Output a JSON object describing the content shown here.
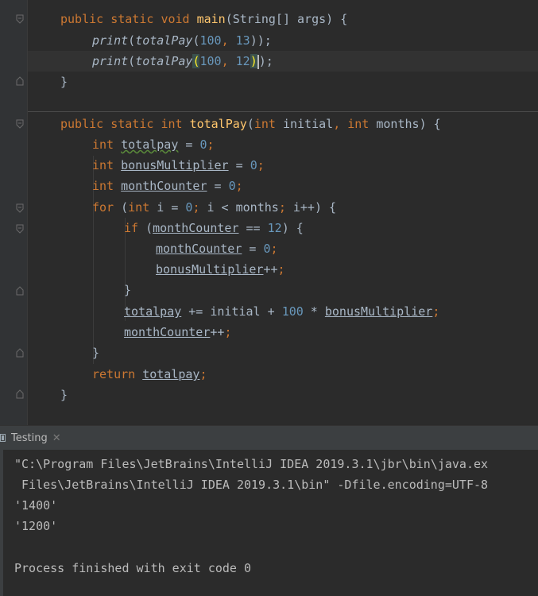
{
  "editor": {
    "main_sig": {
      "kw1": "public",
      "kw2": "static",
      "kw3": "void",
      "name": "main",
      "params": "(String[] args) {"
    },
    "print1": {
      "fn": "print",
      "inner": "totalPay",
      "a": "100",
      "b": "13",
      "close": "));"
    },
    "print2": {
      "fn": "print",
      "inner": "totalPay",
      "a": "100",
      "b": "12",
      "close": ");"
    },
    "close1": "}",
    "total_sig": {
      "kw1": "public",
      "kw2": "static",
      "kw3": "int",
      "name": "totalPay",
      "p1t": "int",
      "p1": "initial",
      "p2t": "int",
      "p2": "months",
      "end": ") {"
    },
    "decl1": {
      "type": "int",
      "name": "totalpay",
      "val": "0"
    },
    "decl2": {
      "type": "int",
      "name": "bonusMultiplier",
      "val": "0"
    },
    "decl3": {
      "type": "int",
      "name": "monthCounter",
      "val": "0"
    },
    "for_line": {
      "kw": "for",
      "t": "int",
      "v": "i",
      "zero": "0",
      "cond": "i < months",
      "inc": "i++"
    },
    "if_line": {
      "kw": "if",
      "var": "monthCounter",
      "op": "==",
      "num": "12"
    },
    "assign1": {
      "var": "monthCounter",
      "val": "0"
    },
    "inc1": {
      "var": "bonusMultiplier",
      "op": "++"
    },
    "close_if": "}",
    "accum": {
      "var": "totalpay",
      "op": "+=",
      "rhs": "initial + ",
      "num": "100",
      "mul": " * ",
      "var2": "bonusMultiplier"
    },
    "inc2": {
      "var": "monthCounter",
      "op": "++"
    },
    "close_for": "}",
    "ret": {
      "kw": "return",
      "var": "totalpay"
    },
    "close_method": "}"
  },
  "toolbar": {
    "tab_label": "Testing",
    "close_glyph": "✕",
    "tab_icon": "console-icon"
  },
  "console": {
    "lines": [
      "\"C:\\Program Files\\JetBrains\\IntelliJ IDEA 2019.3.1\\jbr\\bin\\java.ex",
      " Files\\JetBrains\\IntelliJ IDEA 2019.3.1\\bin\" -Dfile.encoding=UTF-8",
      "'1400'",
      "'1200'",
      "",
      "Process finished with exit code 0"
    ]
  },
  "colors": {
    "keyword": "#cc7832",
    "function": "#ffc66d",
    "number": "#6897bb",
    "text": "#a9b7c6",
    "background": "#2b2b2b"
  }
}
